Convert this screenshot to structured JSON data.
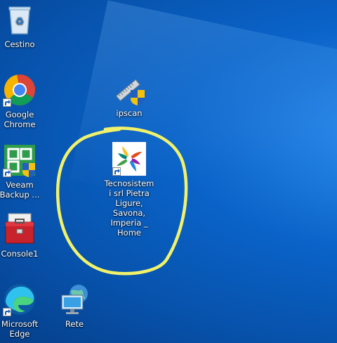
{
  "desktop": {
    "icons": [
      {
        "id": "recycle-bin",
        "label": "Cestino"
      },
      {
        "id": "chrome",
        "label": "Google Chrome"
      },
      {
        "id": "ipscan",
        "label": "ipscan"
      },
      {
        "id": "veeam",
        "label": "Veeam Backup ..."
      },
      {
        "id": "tecnosistemi",
        "label": "Tecnosistemi srl Pietra Ligure, Savona, Imperia _ Home"
      },
      {
        "id": "console1",
        "label": "Console1"
      },
      {
        "id": "edge",
        "label": "Microsoft Edge"
      },
      {
        "id": "network",
        "label": "Rete"
      }
    ]
  },
  "colors": {
    "wallpaper": "#0a63c8",
    "annotation": "#f2f26a"
  }
}
